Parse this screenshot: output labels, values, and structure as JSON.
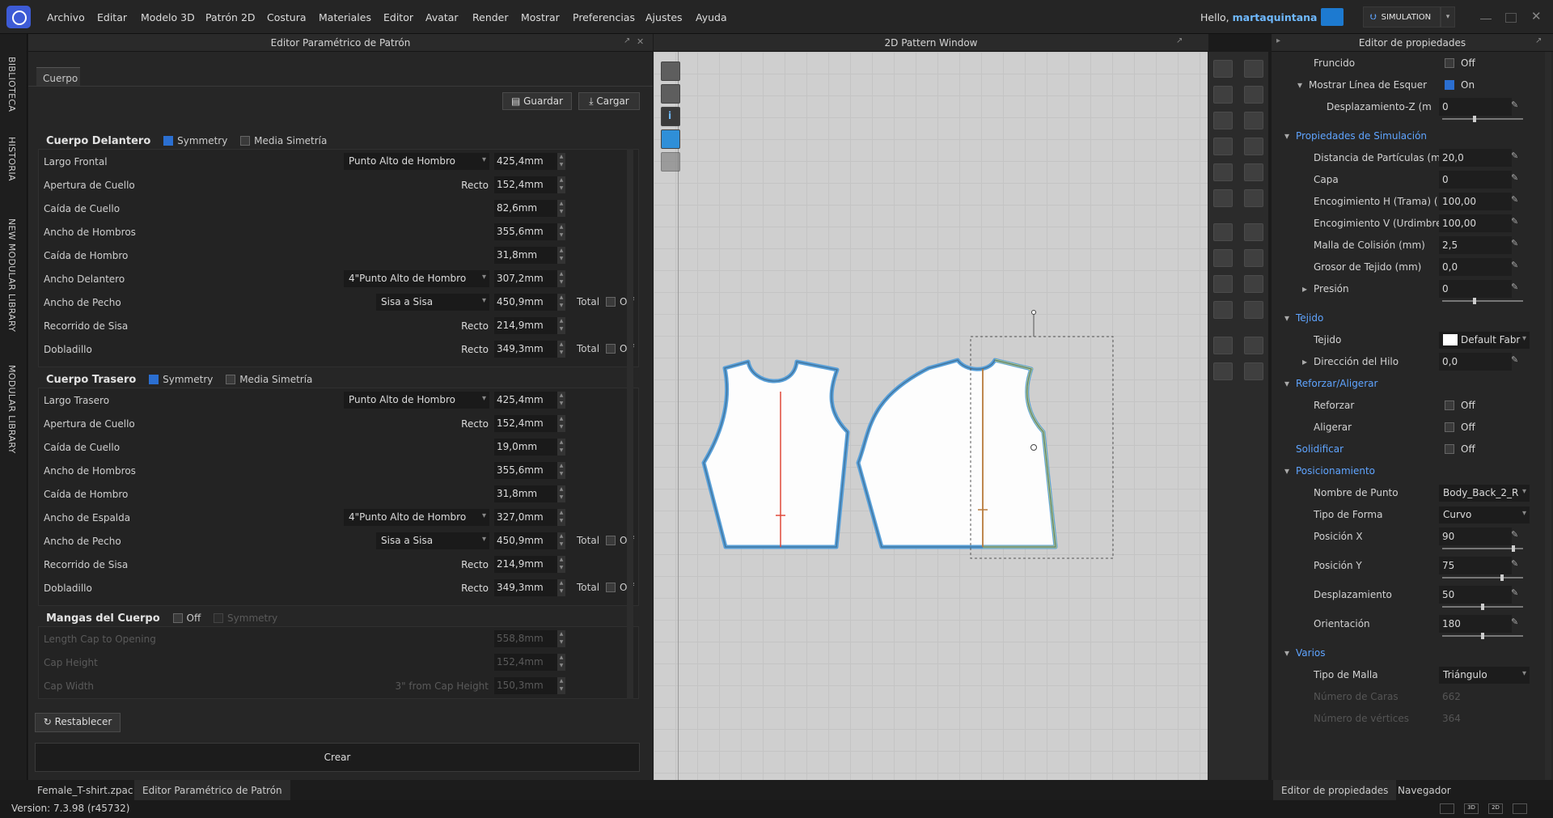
{
  "menubar": {
    "items": [
      "Archivo",
      "Editar",
      "Modelo 3D",
      "Patrón 2D",
      "Costura",
      "Materiales",
      "Editor",
      "Avatar",
      "Render",
      "Mostrar",
      "Preferencias",
      "Ajustes",
      "Ayuda"
    ],
    "hello_prefix": "Hello,",
    "username": "martaquintana",
    "mode": "SIMULATION"
  },
  "side_tabs": [
    "BIBLIOTECA",
    "HISTORIA",
    "NEW MODULAR LIBRARY",
    "MODULAR LIBRARY"
  ],
  "left_panel": {
    "title": "Editor Paramétrico de Patrón",
    "tab": "Cuerpo",
    "save": "Guardar",
    "load": "Cargar",
    "front": {
      "title": "Cuerpo Delantero",
      "symmetry": "Symmetry",
      "half_symmetry": "Media Simetría",
      "rows": [
        {
          "label": "Largo Frontal",
          "dd": "Punto Alto de Hombro",
          "value": "425,4mm"
        },
        {
          "label": "Apertura de Cuello",
          "plain": "Recto",
          "value": "152,4mm"
        },
        {
          "label": "Caída de Cuello",
          "value": "82,6mm"
        },
        {
          "label": "Ancho de Hombros",
          "value": "355,6mm"
        },
        {
          "label": "Caída de Hombro",
          "value": "31,8mm"
        },
        {
          "label": "Ancho Delantero",
          "dd": "4\"Punto Alto de Hombro",
          "value": "307,2mm"
        },
        {
          "label": "Ancho de Pecho",
          "dd": "Sisa a Sisa",
          "value": "450,9mm",
          "extra": "Total",
          "extra_val": "Off"
        },
        {
          "label": "Recorrido de Sisa",
          "plain": "Recto",
          "value": "214,9mm"
        },
        {
          "label": "Dobladillo",
          "plain": "Recto",
          "value": "349,3mm",
          "extra": "Total",
          "extra_val": "Off"
        }
      ]
    },
    "back": {
      "title": "Cuerpo Trasero",
      "symmetry": "Symmetry",
      "half_symmetry": "Media Simetría",
      "rows": [
        {
          "label": "Largo Trasero",
          "dd": "Punto Alto de Hombro",
          "value": "425,4mm"
        },
        {
          "label": "Apertura de Cuello",
          "plain": "Recto",
          "value": "152,4mm"
        },
        {
          "label": "Caída de Cuello",
          "value": "19,0mm"
        },
        {
          "label": "Ancho de Hombros",
          "value": "355,6mm"
        },
        {
          "label": "Caída de Hombro",
          "value": "31,8mm"
        },
        {
          "label": "Ancho de Espalda",
          "dd": "4\"Punto Alto de Hombro",
          "value": "327,0mm"
        },
        {
          "label": "Ancho de Pecho",
          "dd": "Sisa a Sisa",
          "value": "450,9mm",
          "extra": "Total",
          "extra_val": "Off"
        },
        {
          "label": "Recorrido de Sisa",
          "plain": "Recto",
          "value": "214,9mm"
        },
        {
          "label": "Dobladillo",
          "plain": "Recto",
          "value": "349,3mm",
          "extra": "Total",
          "extra_val": "Off"
        }
      ]
    },
    "sleeves": {
      "title": "Mangas del Cuerpo",
      "toggle": "Off",
      "symmetry": "Symmetry",
      "rows": [
        {
          "label": "Length Cap to Opening",
          "value": "558,8mm"
        },
        {
          "label": "Cap Height",
          "value": "152,4mm"
        },
        {
          "label": "Cap Width",
          "plain": "3\" from Cap Height",
          "value": "150,3mm"
        }
      ]
    },
    "reset": "Restablecer",
    "create": "Crear"
  },
  "canvas_panel": {
    "title": "2D Pattern Window"
  },
  "right_panel": {
    "title": "Editor de propiedades",
    "rows": [
      {
        "label": "Fruncido",
        "checkbox": false,
        "value": "Off",
        "indent": 2
      },
      {
        "label": "Mostrar Línea de Esquer",
        "checkbox": true,
        "value": "On",
        "indent": 1,
        "expand": "open"
      },
      {
        "label": "Desplazamiento-Z (m",
        "value": "0",
        "pen": true,
        "slider": 0.4,
        "indent": 3,
        "tall": true
      },
      {
        "cat": "Propiedades de Simulación",
        "expand": "open"
      },
      {
        "label": "Distancia de Partículas (m",
        "value": "20,0",
        "pen": true,
        "indent": 2
      },
      {
        "label": "Capa",
        "value": "0",
        "pen": true,
        "indent": 2
      },
      {
        "label": "Encogimiento H (Trama) (",
        "value": "100,00",
        "pen": true,
        "indent": 2
      },
      {
        "label": "Encogimiento V (Urdimbre)",
        "value": "100,00",
        "pen": true,
        "indent": 2
      },
      {
        "label": "Malla de Colisión (mm)",
        "value": "2,5",
        "pen": true,
        "indent": 2
      },
      {
        "label": "Grosor de Tejido (mm)",
        "value": "0,0",
        "pen": true,
        "indent": 2
      },
      {
        "label": "Presión",
        "value": "0",
        "pen": true,
        "slider": 0.4,
        "indent": 2,
        "expand": "closed",
        "tall": true
      },
      {
        "cat": "Tejido",
        "expand": "open"
      },
      {
        "label": "Tejido",
        "select": "Default Fabr",
        "swatch": true,
        "indent": 2
      },
      {
        "label": "Dirección del Hilo",
        "value": "0,0",
        "pen": true,
        "indent": 2,
        "expand": "closed"
      },
      {
        "cat": "Reforzar/Aligerar",
        "expand": "open"
      },
      {
        "label": "Reforzar",
        "checkbox": false,
        "value": "Off",
        "indent": 2
      },
      {
        "label": "Aligerar",
        "checkbox": false,
        "value": "Off",
        "indent": 2
      },
      {
        "cat": "Solidificar",
        "checkbox": false,
        "value": "Off"
      },
      {
        "cat": "Posicionamiento",
        "expand": "open"
      },
      {
        "label": "Nombre de Punto",
        "select": "Body_Back_2_R",
        "indent": 2
      },
      {
        "label": "Tipo de Forma",
        "select": "Curvo",
        "indent": 2
      },
      {
        "label": "Posición X",
        "value": "90",
        "pen": true,
        "slider": 0.9,
        "indent": 2,
        "tall": true
      },
      {
        "label": "Posición Y",
        "value": "75",
        "pen": true,
        "slider": 0.75,
        "indent": 2,
        "tall": true
      },
      {
        "label": "Desplazamiento",
        "value": "50",
        "pen": true,
        "slider": 0.5,
        "indent": 2,
        "tall": true
      },
      {
        "label": "Orientación",
        "value": "180",
        "pen": true,
        "slider": 0.5,
        "indent": 2,
        "tall": true
      },
      {
        "cat": "Varios",
        "expand": "open"
      },
      {
        "label": "Tipo de Malla",
        "select": "Triángulo",
        "indent": 2
      },
      {
        "label": "Número de Caras",
        "value": "662",
        "indent": 2,
        "dim": true
      },
      {
        "label": "Número de vértices",
        "value": "364",
        "indent": 2,
        "dim": true
      }
    ]
  },
  "bottom_tabs": {
    "left": [
      "Female_T-shirt.zpac",
      "Editor Paramétrico de Patrón"
    ],
    "right": [
      "Editor de propiedades",
      "Navegador"
    ]
  },
  "status": {
    "version": "Version: 7.3.98 (r45732)"
  },
  "colors": {
    "accent": "#2b6fd1",
    "link": "#5fa4ff",
    "pattern_outline": "#5aa0d8",
    "grainline": "#e04a3a",
    "selection": "#f2e94a"
  }
}
